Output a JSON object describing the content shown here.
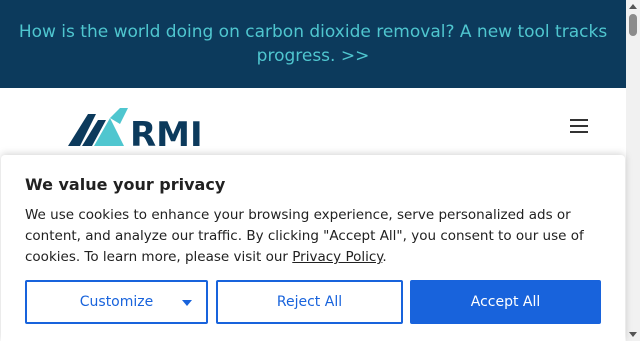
{
  "banner": {
    "text": "How is the world doing on carbon dioxide removal? A new tool tracks progress. >>"
  },
  "header": {
    "logo_text": "RMI",
    "menu_icon": "hamburger-menu-icon"
  },
  "consent": {
    "title": "We value your privacy",
    "body_text": "We use cookies to enhance your browsing experience, serve personalized ads or content, and analyze our traffic. By clicking \"Accept All\", you consent to our use of cookies. To learn more, please visit our ",
    "policy_link": "Privacy Policy",
    "body_end": ".",
    "customize_label": "Customize",
    "reject_label": "Reject All",
    "accept_label": "Accept All"
  },
  "colors": {
    "banner_bg": "#0c3a5c",
    "banner_text": "#4fc6cf",
    "accent": "#1863dc",
    "logo_dark": "#0c3a5c",
    "logo_teal": "#4fc6cf"
  }
}
